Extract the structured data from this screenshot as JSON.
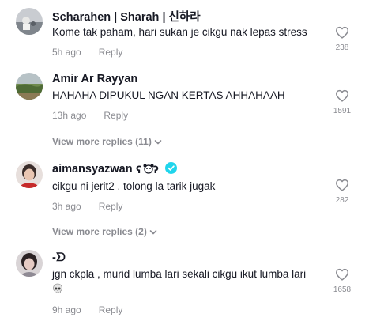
{
  "comments": [
    {
      "username": "Scharahen | Sharah | 신하라",
      "text": "Kome tak paham, hari sukan je cikgu nak lepas stress",
      "age": "5h ago",
      "reply_label": "Reply",
      "likes": "238",
      "avatar_icon": "avatar-photo"
    },
    {
      "username": "Amir Ar Rayyan",
      "text": "HAHAHA DIPUKUL NGAN KERTAS AHHAHAAH",
      "age": "13h ago",
      "reply_label": "Reply",
      "likes": "1591",
      "view_more": "View more replies (11)",
      "avatar_icon": "avatar-photo"
    },
    {
      "username": "aimansyazwan",
      "text": "cikgu ni jerit2 . tolong la tarik jugak",
      "age": "3h ago",
      "reply_label": "Reply",
      "likes": "282",
      "view_more": "View more replies (2)",
      "verified": true,
      "avatar_icon": "avatar-photo"
    },
    {
      "username": "-ᗤ",
      "text": "jgn ckpla , murid lumba lari sekali cikgu ikut lumba lari",
      "age": "9h ago",
      "reply_label": "Reply",
      "likes": "1658",
      "trailing_emoji": "skull-emoji",
      "avatar_icon": "avatar-photo"
    }
  ],
  "colors": {
    "text_primary": "#161823",
    "text_secondary": "#8a8b91",
    "verified_blue": "#20d5ec"
  }
}
